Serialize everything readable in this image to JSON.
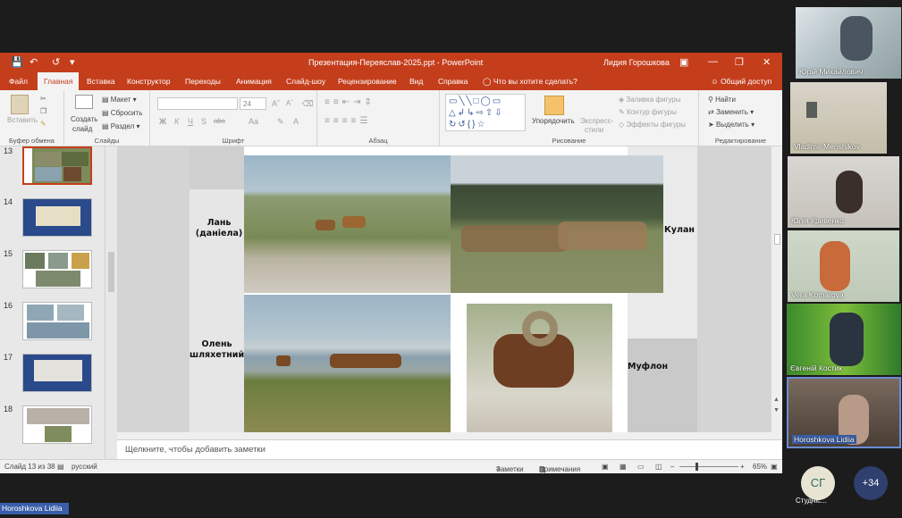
{
  "window": {
    "title": "Презентация-Переяслав-2025.ppt  -  PowerPoint",
    "user": "Лидия Горошкова"
  },
  "tabs": [
    "Файл",
    "Главная",
    "Вставка",
    "Конструктор",
    "Переходы",
    "Анимация",
    "Слайд-шоу",
    "Рецензирование",
    "Вид",
    "Справка"
  ],
  "active_tab": "Главная",
  "tell_me": "Что вы хотите сделать?",
  "share": "Общий доступ",
  "ribbon": {
    "clipboard": {
      "paste": "Вставить",
      "label": "Буфер обмена"
    },
    "slides": {
      "new_slide_1": "Создать",
      "new_slide_2": "слайд",
      "layout": "Макет",
      "reset": "Сбросить",
      "section": "Раздел",
      "label": "Слайды"
    },
    "font": {
      "font_size": "24",
      "bold": "Ж",
      "italic": "К",
      "underline": "Ч",
      "strike": "S",
      "spacing": "abc",
      "case": "Aa",
      "label": "Шрифт"
    },
    "paragraph": {
      "label": "Абзац"
    },
    "drawing": {
      "arrange": "Упорядочить",
      "quick_styles_1": "Экспресс-",
      "quick_styles_2": "стили",
      "fill": "Заливка фигуры",
      "outline": "Контур фигуры",
      "effects": "Эффекты фигуры",
      "label": "Рисование"
    },
    "editing": {
      "find": "Найти",
      "replace": "Заменить",
      "select": "Выделить",
      "label": "Редактирование"
    }
  },
  "thumbnails": [
    {
      "num": "13",
      "selected": true
    },
    {
      "num": "14",
      "selected": false
    },
    {
      "num": "15",
      "selected": false
    },
    {
      "num": "16",
      "selected": false
    },
    {
      "num": "17",
      "selected": false
    },
    {
      "num": "18",
      "selected": false
    }
  ],
  "slide": {
    "label_lan": "Лань (даніела)",
    "label_kulan": "Кулан",
    "label_olen": "Олень шляхетний",
    "label_muflon": "Муфлон"
  },
  "notes_placeholder": "Щелкните, чтобы добавить заметки",
  "status": {
    "slide": "Слайд 13 из 38",
    "language": "русский",
    "notes": "Заметки",
    "comments": "Примечания",
    "zoom": "65%"
  },
  "participants": [
    {
      "name": "Юрій Михайлович"
    },
    {
      "name": "Vladimir Menshikov"
    },
    {
      "name": "Юлія  Кривенко"
    },
    {
      "name": "Vera Komarova"
    },
    {
      "name": "Євгеній Костик"
    },
    {
      "name": "Horoshkova Lidiia"
    }
  ],
  "bottom": {
    "avatar_initials": "СГ",
    "avatar_name": "Студніс...",
    "more_count": "+34",
    "self_name": "Horoshkova Lidiia"
  }
}
